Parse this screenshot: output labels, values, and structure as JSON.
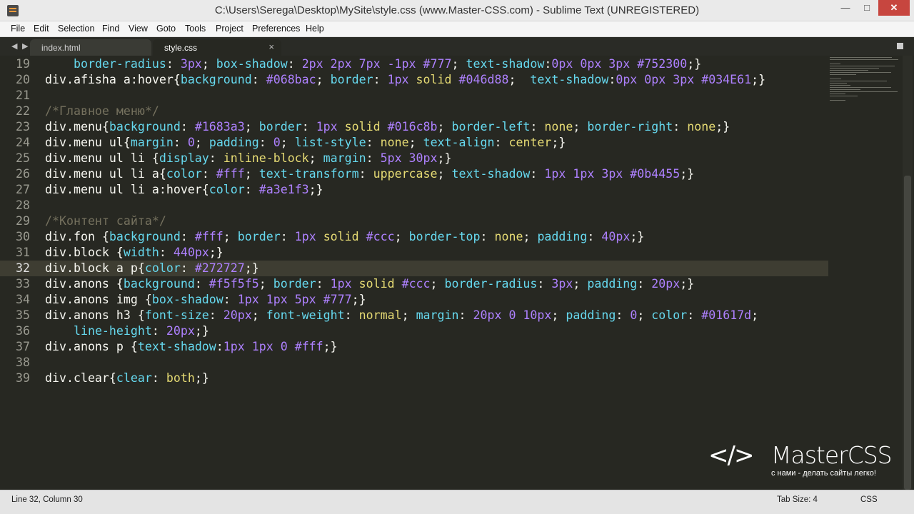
{
  "window": {
    "title": "C:\\Users\\Serega\\Desktop\\MySite\\style.css (www.Master-CSS.com) - Sublime Text (UNREGISTERED)",
    "minimize": "—",
    "maximize": "□",
    "close": "✕"
  },
  "menu": [
    "File",
    "Edit",
    "Selection",
    "Find",
    "View",
    "Goto",
    "Tools",
    "Project",
    "Preferences",
    "Help"
  ],
  "tabs": [
    {
      "label": "index.html",
      "active": false
    },
    {
      "label": "style.css",
      "active": true
    }
  ],
  "tab_close": "×",
  "nav": {
    "back": "◀",
    "forward": "▶"
  },
  "editor": {
    "current_line": 32,
    "lines": [
      {
        "n": "19",
        "tokens": [
          [
            "    ",
            ""
          ],
          [
            "border-radius",
            "prop"
          ],
          [
            ": ",
            "p"
          ],
          [
            "3px",
            "val"
          ],
          [
            "; ",
            "p"
          ],
          [
            "box-shadow",
            "prop"
          ],
          [
            ": ",
            "p"
          ],
          [
            "2px 2px 7px -1px #777",
            "val"
          ],
          [
            "; ",
            "p"
          ],
          [
            "text-shadow",
            "prop"
          ],
          [
            ":",
            "p"
          ],
          [
            "0px 0px 3px #752300",
            "val"
          ],
          [
            ";}",
            "p"
          ]
        ]
      },
      {
        "n": "20",
        "tokens": [
          [
            "div.afisha a:hover",
            "sel"
          ],
          [
            "{",
            "p"
          ],
          [
            "background",
            "prop"
          ],
          [
            ": ",
            "p"
          ],
          [
            "#068bac",
            "val"
          ],
          [
            "; ",
            "p"
          ],
          [
            "border",
            "prop"
          ],
          [
            ": ",
            "p"
          ],
          [
            "1px ",
            "val"
          ],
          [
            "solid ",
            "kw"
          ],
          [
            "#046d88",
            "val"
          ],
          [
            ";  ",
            "p"
          ],
          [
            "text-shadow",
            "prop"
          ],
          [
            ":",
            "p"
          ],
          [
            "0px 0px 3px #034E61",
            "val"
          ],
          [
            ";}",
            "p"
          ]
        ]
      },
      {
        "n": "21",
        "tokens": []
      },
      {
        "n": "22",
        "tokens": [
          [
            "/*Главное меню*/",
            "com"
          ]
        ]
      },
      {
        "n": "23",
        "tokens": [
          [
            "div.menu",
            "sel"
          ],
          [
            "{",
            "p"
          ],
          [
            "background",
            "prop"
          ],
          [
            ": ",
            "p"
          ],
          [
            "#1683a3",
            "val"
          ],
          [
            "; ",
            "p"
          ],
          [
            "border",
            "prop"
          ],
          [
            ": ",
            "p"
          ],
          [
            "1px ",
            "val"
          ],
          [
            "solid ",
            "kw"
          ],
          [
            "#016c8b",
            "val"
          ],
          [
            "; ",
            "p"
          ],
          [
            "border-left",
            "prop"
          ],
          [
            ": ",
            "p"
          ],
          [
            "none",
            "kw"
          ],
          [
            "; ",
            "p"
          ],
          [
            "border-right",
            "prop"
          ],
          [
            ": ",
            "p"
          ],
          [
            "none",
            "kw"
          ],
          [
            ";}",
            "p"
          ]
        ]
      },
      {
        "n": "24",
        "tokens": [
          [
            "div.menu ul",
            "sel"
          ],
          [
            "{",
            "p"
          ],
          [
            "margin",
            "prop"
          ],
          [
            ": ",
            "p"
          ],
          [
            "0",
            "val"
          ],
          [
            "; ",
            "p"
          ],
          [
            "padding",
            "prop"
          ],
          [
            ": ",
            "p"
          ],
          [
            "0",
            "val"
          ],
          [
            "; ",
            "p"
          ],
          [
            "list-style",
            "prop"
          ],
          [
            ": ",
            "p"
          ],
          [
            "none",
            "kw"
          ],
          [
            "; ",
            "p"
          ],
          [
            "text-align",
            "prop"
          ],
          [
            ": ",
            "p"
          ],
          [
            "center",
            "kw"
          ],
          [
            ";}",
            "p"
          ]
        ]
      },
      {
        "n": "25",
        "tokens": [
          [
            "div.menu ul li ",
            "sel"
          ],
          [
            "{",
            "p"
          ],
          [
            "display",
            "prop"
          ],
          [
            ": ",
            "p"
          ],
          [
            "inline-block",
            "kw"
          ],
          [
            "; ",
            "p"
          ],
          [
            "margin",
            "prop"
          ],
          [
            ": ",
            "p"
          ],
          [
            "5px 30px",
            "val"
          ],
          [
            ";}",
            "p"
          ]
        ]
      },
      {
        "n": "26",
        "tokens": [
          [
            "div.menu ul li a",
            "sel"
          ],
          [
            "{",
            "p"
          ],
          [
            "color",
            "prop"
          ],
          [
            ": ",
            "p"
          ],
          [
            "#fff",
            "val"
          ],
          [
            "; ",
            "p"
          ],
          [
            "text-transform",
            "prop"
          ],
          [
            ": ",
            "p"
          ],
          [
            "uppercase",
            "kw"
          ],
          [
            "; ",
            "p"
          ],
          [
            "text-shadow",
            "prop"
          ],
          [
            ": ",
            "p"
          ],
          [
            "1px 1px 3px #0b4455",
            "val"
          ],
          [
            ";}",
            "p"
          ]
        ]
      },
      {
        "n": "27",
        "tokens": [
          [
            "div.menu ul li a:hover",
            "sel"
          ],
          [
            "{",
            "p"
          ],
          [
            "color",
            "prop"
          ],
          [
            ": ",
            "p"
          ],
          [
            "#a3e1f3",
            "val"
          ],
          [
            ";}",
            "p"
          ]
        ]
      },
      {
        "n": "28",
        "tokens": []
      },
      {
        "n": "29",
        "tokens": [
          [
            "/*Контент сайта*/",
            "com"
          ]
        ]
      },
      {
        "n": "30",
        "tokens": [
          [
            "div.fon ",
            "sel"
          ],
          [
            "{",
            "p"
          ],
          [
            "background",
            "prop"
          ],
          [
            ": ",
            "p"
          ],
          [
            "#fff",
            "val"
          ],
          [
            "; ",
            "p"
          ],
          [
            "border",
            "prop"
          ],
          [
            ": ",
            "p"
          ],
          [
            "1px ",
            "val"
          ],
          [
            "solid ",
            "kw"
          ],
          [
            "#ccc",
            "val"
          ],
          [
            "; ",
            "p"
          ],
          [
            "border-top",
            "prop"
          ],
          [
            ": ",
            "p"
          ],
          [
            "none",
            "kw"
          ],
          [
            "; ",
            "p"
          ],
          [
            "padding",
            "prop"
          ],
          [
            ": ",
            "p"
          ],
          [
            "40px",
            "val"
          ],
          [
            ";}",
            "p"
          ]
        ]
      },
      {
        "n": "31",
        "tokens": [
          [
            "div.block ",
            "sel"
          ],
          [
            "{",
            "p"
          ],
          [
            "width",
            "prop"
          ],
          [
            ": ",
            "p"
          ],
          [
            "440px",
            "val"
          ],
          [
            ";}",
            "p"
          ]
        ]
      },
      {
        "n": "32",
        "tokens": [
          [
            "div.block a p",
            "sel"
          ],
          [
            "{",
            "p"
          ],
          [
            "color",
            "prop"
          ],
          [
            ": ",
            "p"
          ],
          [
            "#272727",
            "val"
          ],
          [
            ";}",
            "p"
          ]
        ]
      },
      {
        "n": "33",
        "tokens": [
          [
            "div.anons ",
            "sel"
          ],
          [
            "{",
            "p"
          ],
          [
            "background",
            "prop"
          ],
          [
            ": ",
            "p"
          ],
          [
            "#f5f5f5",
            "val"
          ],
          [
            "; ",
            "p"
          ],
          [
            "border",
            "prop"
          ],
          [
            ": ",
            "p"
          ],
          [
            "1px ",
            "val"
          ],
          [
            "solid ",
            "kw"
          ],
          [
            "#ccc",
            "val"
          ],
          [
            "; ",
            "p"
          ],
          [
            "border-radius",
            "prop"
          ],
          [
            ": ",
            "p"
          ],
          [
            "3px",
            "val"
          ],
          [
            "; ",
            "p"
          ],
          [
            "padding",
            "prop"
          ],
          [
            ": ",
            "p"
          ],
          [
            "20px",
            "val"
          ],
          [
            ";}",
            "p"
          ]
        ]
      },
      {
        "n": "34",
        "tokens": [
          [
            "div.anons img ",
            "sel"
          ],
          [
            "{",
            "p"
          ],
          [
            "box-shadow",
            "prop"
          ],
          [
            ": ",
            "p"
          ],
          [
            "1px 1px 5px #777",
            "val"
          ],
          [
            ";}",
            "p"
          ]
        ]
      },
      {
        "n": "35",
        "tokens": [
          [
            "div.anons h3 ",
            "sel"
          ],
          [
            "{",
            "p"
          ],
          [
            "font-size",
            "prop"
          ],
          [
            ": ",
            "p"
          ],
          [
            "20px",
            "val"
          ],
          [
            "; ",
            "p"
          ],
          [
            "font-weight",
            "prop"
          ],
          [
            ": ",
            "p"
          ],
          [
            "normal",
            "kw"
          ],
          [
            "; ",
            "p"
          ],
          [
            "margin",
            "prop"
          ],
          [
            ": ",
            "p"
          ],
          [
            "20px 0 10px",
            "val"
          ],
          [
            "; ",
            "p"
          ],
          [
            "padding",
            "prop"
          ],
          [
            ": ",
            "p"
          ],
          [
            "0",
            "val"
          ],
          [
            "; ",
            "p"
          ],
          [
            "color",
            "prop"
          ],
          [
            ": ",
            "p"
          ],
          [
            "#01617d",
            "val"
          ],
          [
            ";",
            "p"
          ]
        ]
      },
      {
        "n": "36",
        "tokens": [
          [
            "    ",
            ""
          ],
          [
            "line-height",
            "prop"
          ],
          [
            ": ",
            "p"
          ],
          [
            "20px",
            "val"
          ],
          [
            ";}",
            "p"
          ]
        ]
      },
      {
        "n": "37",
        "tokens": [
          [
            "div.anons p ",
            "sel"
          ],
          [
            "{",
            "p"
          ],
          [
            "text-shadow",
            "prop"
          ],
          [
            ":",
            "p"
          ],
          [
            "1px 1px 0 #fff",
            "val"
          ],
          [
            ";}",
            "p"
          ]
        ]
      },
      {
        "n": "38",
        "tokens": []
      },
      {
        "n": "39",
        "tokens": [
          [
            "div.clear",
            "sel"
          ],
          [
            "{",
            "p"
          ],
          [
            "clear",
            "prop"
          ],
          [
            ": ",
            "p"
          ],
          [
            "both",
            "kw"
          ],
          [
            ";}",
            "p"
          ]
        ]
      }
    ]
  },
  "watermark": {
    "logo": "</>",
    "brand": "MasterCSS",
    "tagline": "с нами - делать сайты легко!"
  },
  "status": {
    "position": "Line 32, Column 30",
    "tab_size": "Tab Size: 4",
    "syntax": "CSS"
  },
  "colors": {
    "background": "#272822",
    "selector": "#f8f8f2",
    "property": "#66d9ef",
    "value": "#ae81ff",
    "keyword": "#e6db74",
    "comment": "#75715e"
  }
}
